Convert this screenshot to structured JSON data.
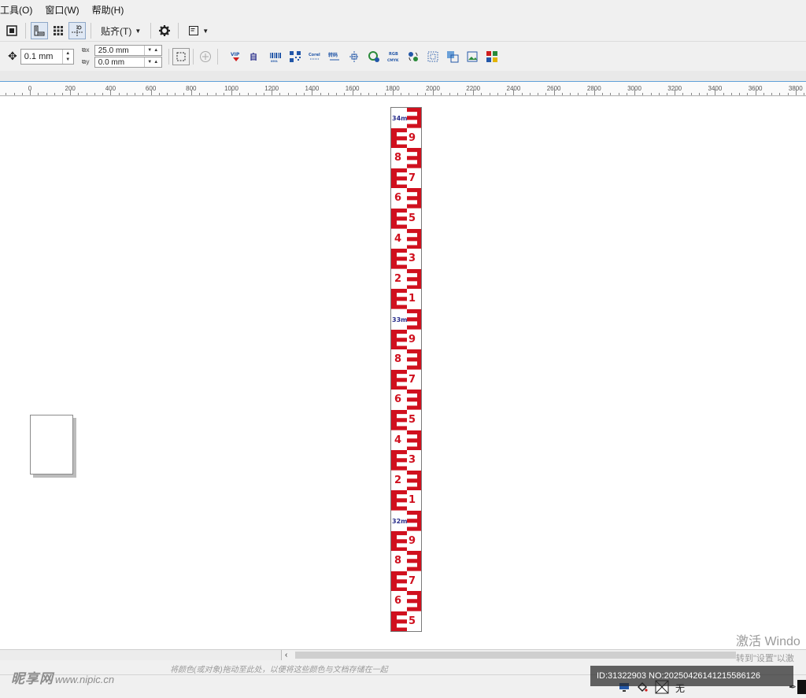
{
  "menu": {
    "items": [
      {
        "label": "工具(O)",
        "name": "menu-tools"
      },
      {
        "label": "窗口(W)",
        "name": "menu-window"
      },
      {
        "label": "帮助(H)",
        "name": "menu-help"
      }
    ]
  },
  "toolbar": {
    "snap_label": "贴齐(T)"
  },
  "property_bar": {
    "nudge_value": "0.1 mm",
    "duplicate_x": "25.0 mm",
    "duplicate_y": "0.0 mm"
  },
  "ruler": {
    "labels": [
      "0",
      "200",
      "400",
      "600",
      "800",
      "1000",
      "1200",
      "1400",
      "1600",
      "1800",
      "2000",
      "2200",
      "2400",
      "2600",
      "2800",
      "3000",
      "3200",
      "3400",
      "3600",
      "3800"
    ]
  },
  "staff": {
    "meter_labels": [
      "34m",
      "33m",
      "32m"
    ],
    "digits_34": [
      "9",
      "8",
      "7",
      "6",
      "5",
      "4",
      "3",
      "2",
      "1"
    ],
    "digits_33": [
      "9",
      "8",
      "7",
      "6",
      "5",
      "4",
      "3",
      "2",
      "1"
    ],
    "digits_32": [
      "9",
      "8",
      "7",
      "6",
      "5"
    ],
    "color_red": "#d0101e",
    "color_blue": "#2a2f8c"
  },
  "bottom": {
    "color_hint": "将颜色(或对象)拖动至此处，以便将这些颜色与文档存储在一起",
    "fill_status": "无"
  },
  "overlay": {
    "watermark_brand": "昵享网",
    "watermark_site": "www.nipic.cn",
    "image_id": "ID:31322903 NO:20250426141215586126",
    "activate_title": "激活 Windo",
    "activate_sub": "转到\"设置\"以激"
  }
}
